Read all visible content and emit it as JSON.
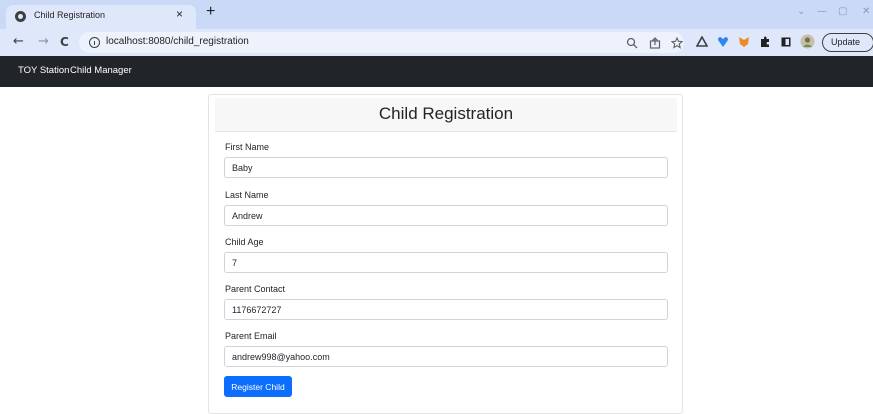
{
  "browser": {
    "tab_title": "Child Registration",
    "tab_close": "×",
    "new_tab": "+",
    "url": "localhost:8080/child_registration",
    "update_label": "Update",
    "window_controls": {
      "chevron": "⌄",
      "minimize": "—",
      "maximize": "▢",
      "close": "✕"
    },
    "nav": {
      "back": "←",
      "forward": "→",
      "reload": "C"
    }
  },
  "navbar": {
    "brand": "TOY Station",
    "link": "Child Manager",
    "bg_color": "#212529"
  },
  "form": {
    "title": "Child Registration",
    "fields": [
      {
        "label": "First Name",
        "value": "Baby"
      },
      {
        "label": "Last Name",
        "value": "Andrew"
      },
      {
        "label": "Child Age",
        "value": "7"
      },
      {
        "label": "Parent Contact",
        "value": "1176672727"
      },
      {
        "label": "Parent Email",
        "value": "andrew998@yahoo.com"
      }
    ],
    "submit_label": "Register Child",
    "submit_color": "#0d6efd"
  },
  "icons": {
    "zoom": "search-icon",
    "share": "share-icon",
    "bookmark": "star-icon",
    "extensions": [
      "triangle-extension-icon",
      "heart-extension-icon",
      "fox-extension-icon",
      "puzzle-icon",
      "sidepanel-icon",
      "avatar-icon"
    ]
  }
}
